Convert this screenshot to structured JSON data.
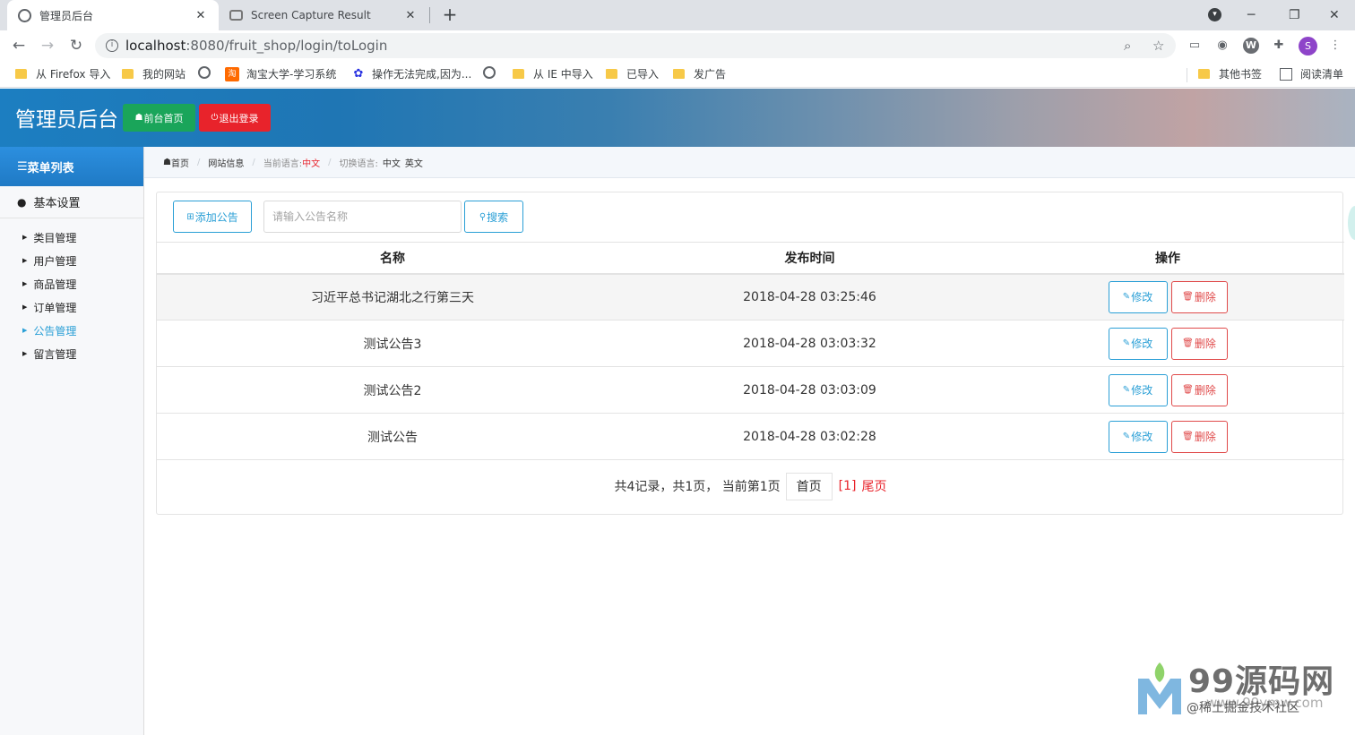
{
  "browser": {
    "tabs": [
      {
        "title": "管理员后台",
        "active": true
      },
      {
        "title": "Screen Capture Result",
        "active": false
      }
    ],
    "url_host": "localhost",
    "url_path": ":8080/fruit_shop/login/toLogin",
    "profile_initial": "S",
    "bookmarks": [
      {
        "label": "从 Firefox 导入",
        "icon": "folder-icon"
      },
      {
        "label": "我的网站",
        "icon": "folder-icon"
      },
      {
        "label": "",
        "icon": "globe-icon"
      },
      {
        "label": "淘宝大学-学习系统",
        "icon": "taobao-icon"
      },
      {
        "label": "操作无法完成,因为...",
        "icon": "baidu-icon"
      },
      {
        "label": "",
        "icon": "globe-icon"
      },
      {
        "label": "从 IE 中导入",
        "icon": "folder-icon"
      },
      {
        "label": "已导入",
        "icon": "folder-icon"
      },
      {
        "label": "发广告",
        "icon": "folder-icon"
      },
      {
        "label": "其他书签",
        "icon": "folder-icon"
      },
      {
        "label": "阅读清单",
        "icon": "reading-list-icon"
      }
    ]
  },
  "header": {
    "title": "管理员后台",
    "home_button": "前台首页",
    "logout_button": "退出登录",
    "home_color": "#1aa55a",
    "logout_color": "#e8232b"
  },
  "sidebar": {
    "menu_title": "菜单列表",
    "group_title": "基本设置",
    "items": [
      {
        "label": "类目管理",
        "active": false
      },
      {
        "label": "用户管理",
        "active": false
      },
      {
        "label": "商品管理",
        "active": false
      },
      {
        "label": "订单管理",
        "active": false
      },
      {
        "label": "公告管理",
        "active": true
      },
      {
        "label": "留言管理",
        "active": false
      }
    ]
  },
  "breadcrumb": {
    "home": "首页",
    "site_info": "网站信息",
    "current_lang_label": "当前语言:",
    "current_lang": "中文",
    "switch_lang_label": "切换语言:",
    "lang_zh": "中文",
    "lang_en": "英文"
  },
  "toolbar": {
    "add_label": "添加公告",
    "search_placeholder": "请输入公告名称",
    "search_value": "",
    "search_label": "搜索"
  },
  "table": {
    "headers": [
      "名称",
      "发布时间",
      "操作"
    ],
    "rows": [
      {
        "name": "习近平总书记湖北之行第三天",
        "time": "2018-04-28 03:25:46"
      },
      {
        "name": "测试公告3",
        "time": "2018-04-28 03:03:32"
      },
      {
        "name": "测试公告2",
        "time": "2018-04-28 03:03:09"
      },
      {
        "name": "测试公告",
        "time": "2018-04-28 03:02:28"
      }
    ],
    "edit_label": "修改",
    "delete_label": "删除"
  },
  "pager": {
    "summary": "共4记录，共1页， 当前第1页",
    "first": "首页",
    "current": "[1]",
    "last": "尾页"
  },
  "watermark": {
    "brand": "99源码网",
    "sub": "@稀土掘金技术社区",
    "sub2": "www.99ymw.com"
  }
}
